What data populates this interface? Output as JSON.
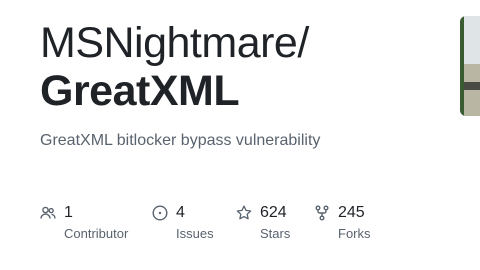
{
  "repo": {
    "owner": "MSNightmare/",
    "name": "GreatXML",
    "description": "GreatXML bitlocker bypass vulnerability"
  },
  "stats": {
    "contributors": {
      "count": "1",
      "label": "Contributor",
      "icon": "people-icon"
    },
    "issues": {
      "count": "4",
      "label": "Issues",
      "icon": "issue-opened-icon"
    },
    "stars": {
      "count": "624",
      "label": "Stars",
      "icon": "star-icon"
    },
    "forks": {
      "count": "245",
      "label": "Forks",
      "icon": "repo-forked-icon"
    }
  },
  "colors": {
    "text_primary": "#1f2328",
    "text_muted": "#59636e"
  }
}
